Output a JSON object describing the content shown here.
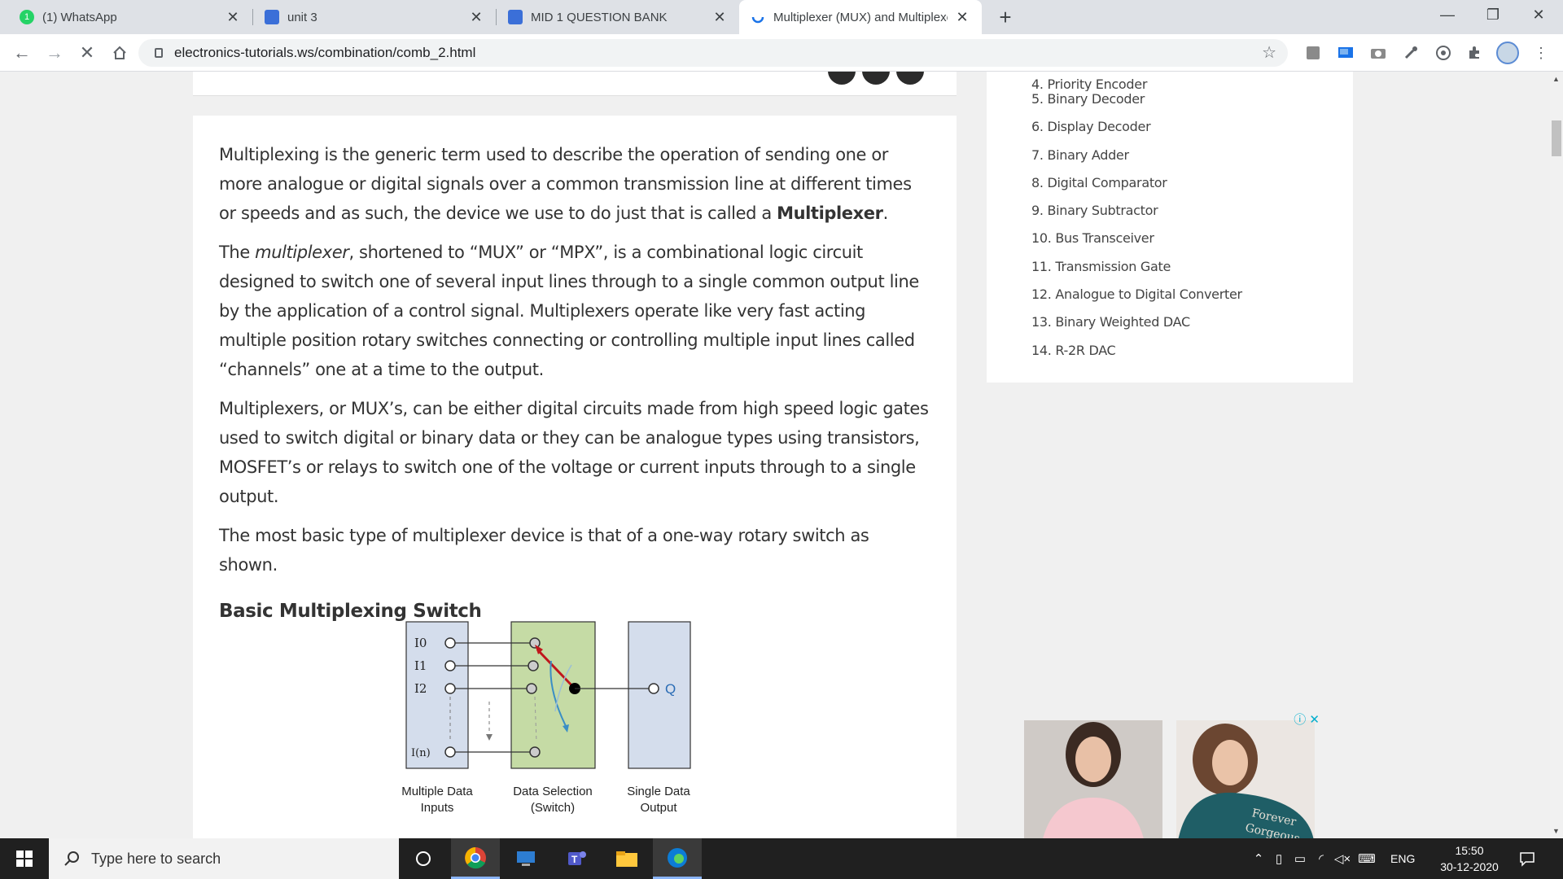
{
  "browser": {
    "tabs": [
      {
        "title": "(1) WhatsApp",
        "fav": "1",
        "fav_color": "#25d366"
      },
      {
        "title": "unit 3",
        "fav": "",
        "fav_color": "#3b6fd8"
      },
      {
        "title": "MID 1 QUESTION BANK",
        "fav": "",
        "fav_color": "#3b6fd8"
      },
      {
        "title": "Multiplexer (MUX) and Multiplexers",
        "fav": "",
        "fav_color": "#1a73e8"
      }
    ],
    "new_tab": "+",
    "window_controls": {
      "minimize": "—",
      "restore": "❐",
      "close": "✕"
    },
    "url": "electronics-tutorials.ws/combination/comb_2.html"
  },
  "article": {
    "p1_start": "Multiplexing is the generic term used to describe the operation of sending one or more analogue or digital signals over a common transmission line at different times or speeds and as such, the device we use to do just that is called a ",
    "p1_bold": "Multiplexer",
    "p1_end": ".",
    "p2_start": "The ",
    "p2_italic": "multiplexer",
    "p2_end": ", shortened to “MUX” or “MPX”, is a combinational logic circuit designed to switch one of several input lines through to a single common output line by the application of a control signal. Multiplexers operate like very fast acting multiple position rotary switches connecting or controlling multiple input lines called “channels” one at a time to the output.",
    "p3": "Multiplexers, or MUX’s, can be either digital circuits made from high speed logic gates used to switch digital or binary data or they can be analogue types using transistors, MOSFET’s or relays to switch one of the voltage or current inputs through to a single output.",
    "p4": "The most basic type of multiplexer device is that of a one-way rotary switch as shown.",
    "heading": "Basic Multiplexing Switch",
    "diagram": {
      "inputs": [
        "I0",
        "I1",
        "I2",
        "I(n)"
      ],
      "output": "Q",
      "label_inputs": [
        "Multiple Data",
        "Inputs"
      ],
      "label_switch": [
        "Data Selection",
        "(Switch)"
      ],
      "label_output": [
        "Single Data",
        "Output"
      ]
    }
  },
  "sidebar": {
    "partial": "4. Priority Encoder",
    "items": [
      "5. Binary Decoder",
      "6. Display Decoder",
      "7. Binary Adder",
      "8. Digital Comparator",
      "9. Binary Subtractor",
      "10. Bus Transceiver",
      "11. Transmission Gate",
      "12. Analogue to Digital Converter",
      "13. Binary Weighted DAC",
      "14. R-2R DAC"
    ]
  },
  "ad": {
    "shirt_text_1": "Forever",
    "shirt_text_2": "Gorgeous",
    "info": "ⓘ",
    "close": "✕"
  },
  "taskbar": {
    "search_placeholder": "Type here to search",
    "language": "ENG",
    "time": "15:50",
    "date": "30-12-2020"
  }
}
